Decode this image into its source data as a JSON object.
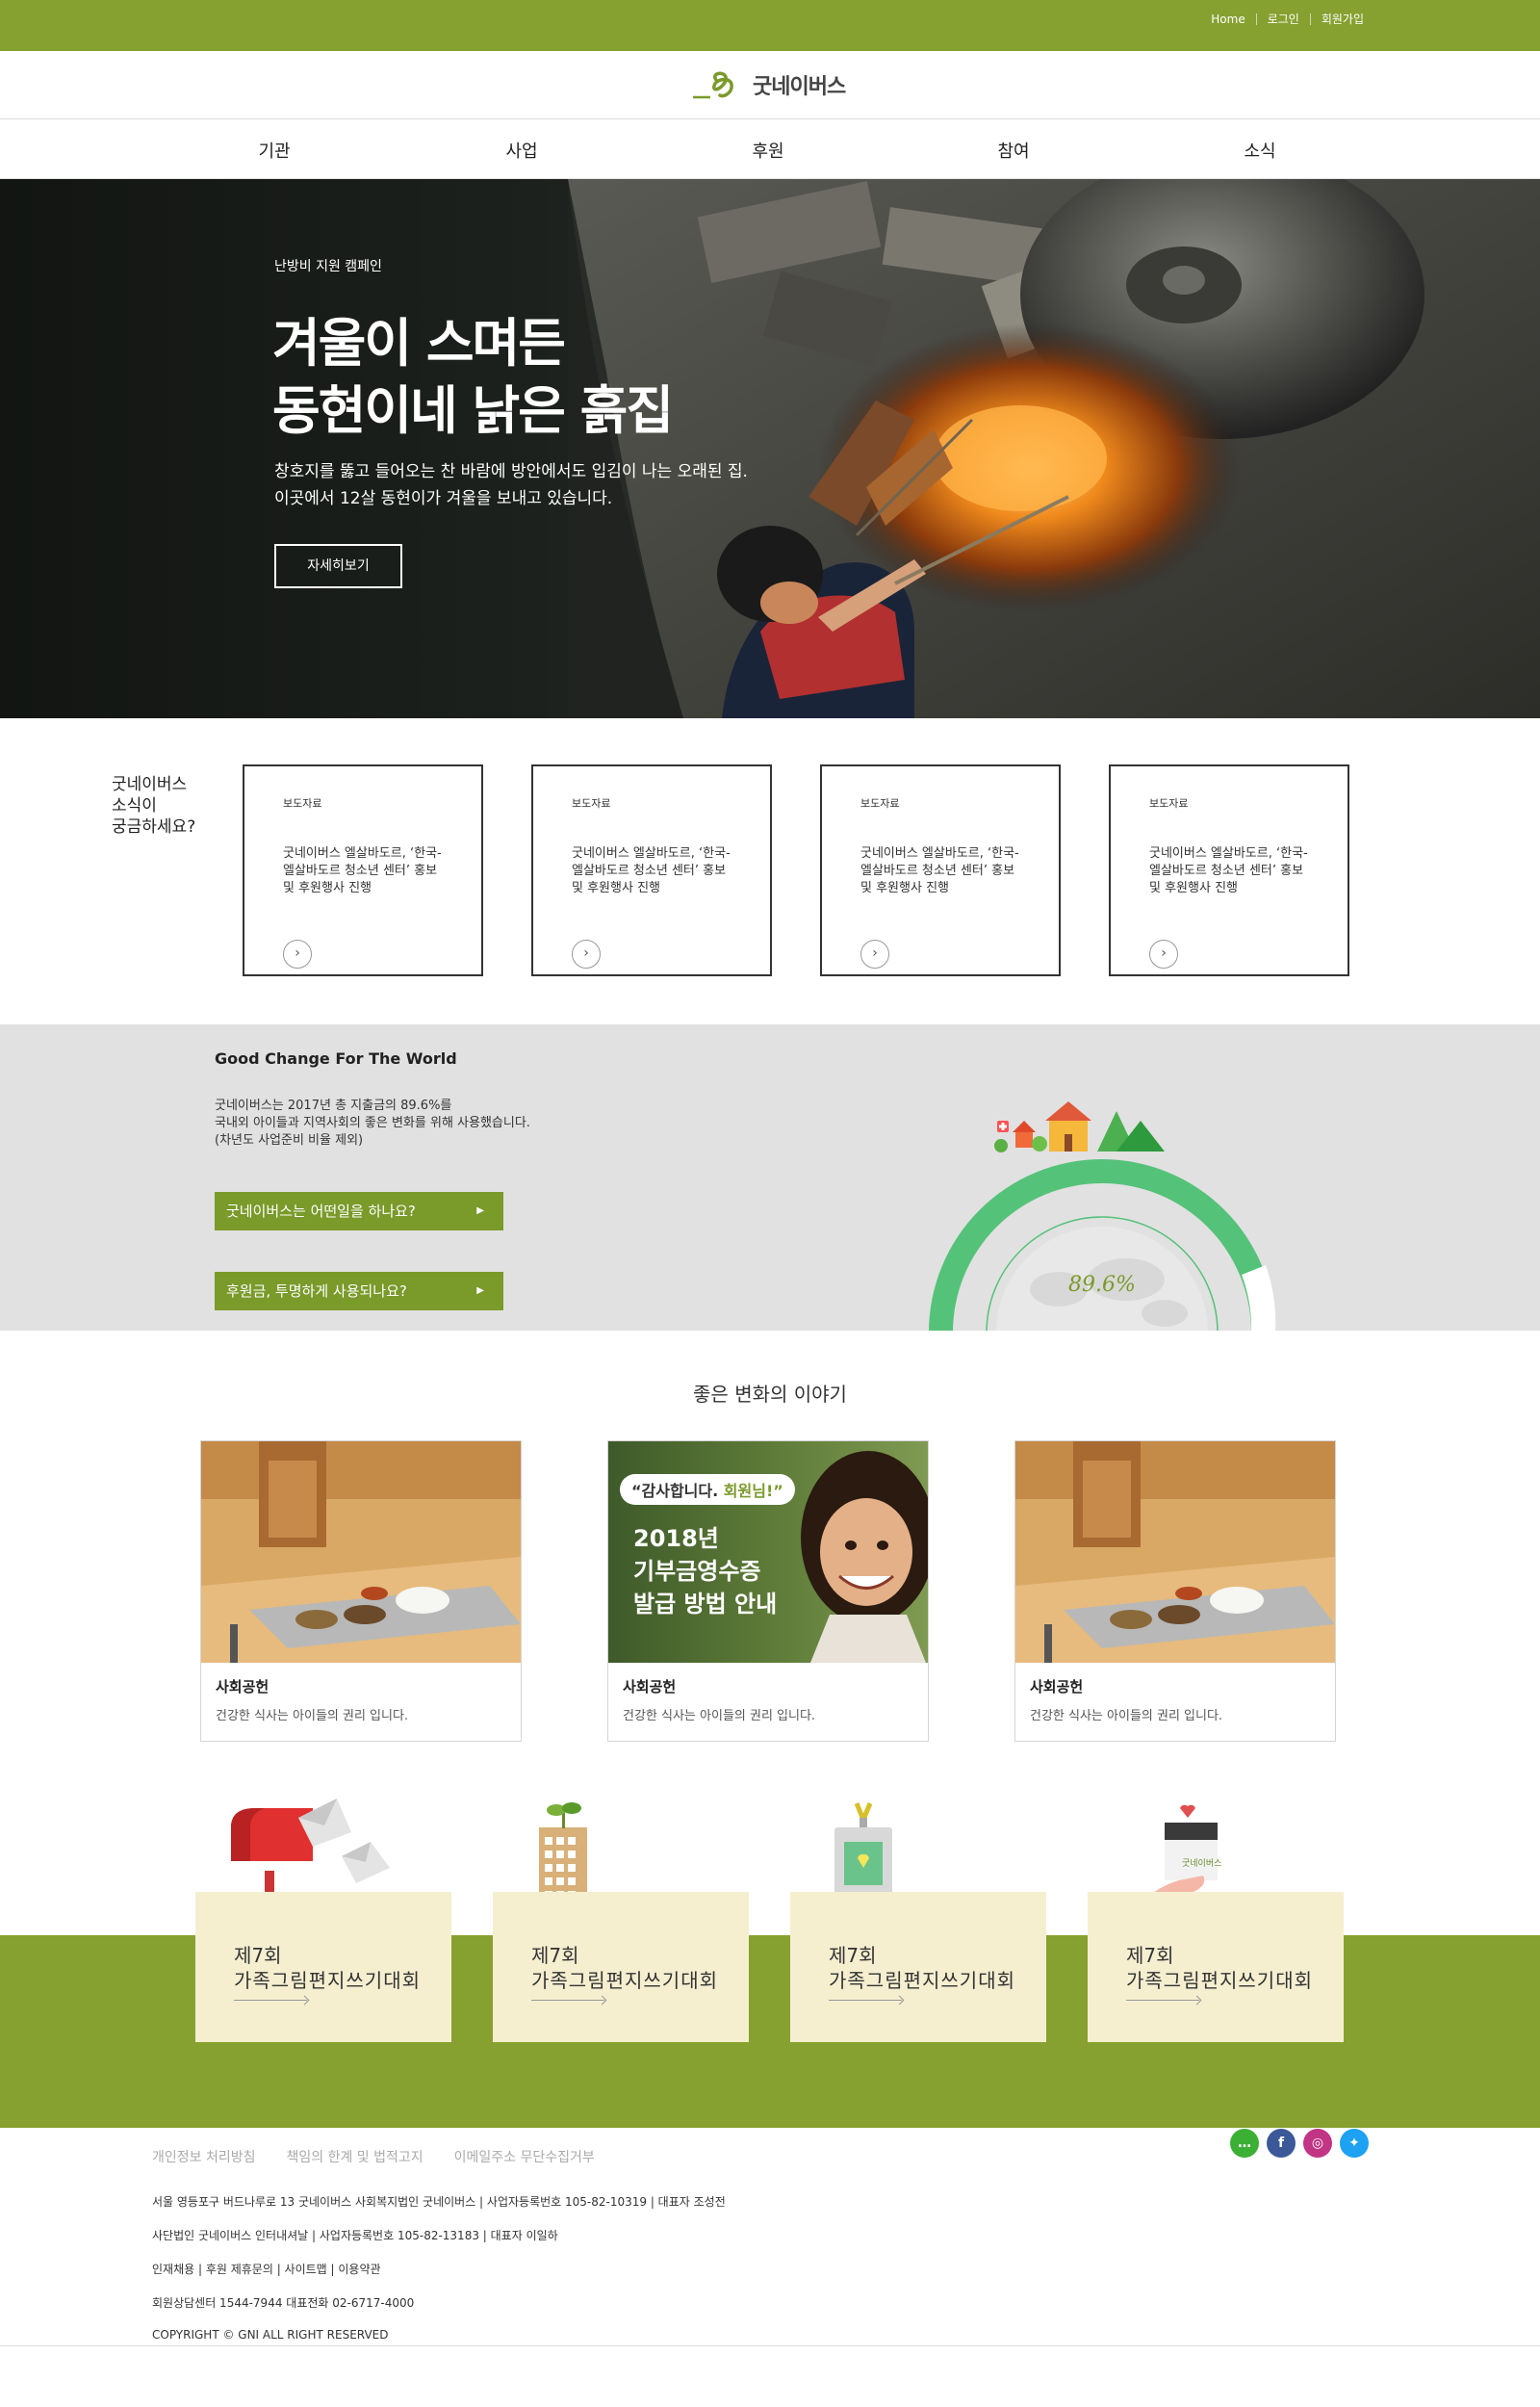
{
  "topbar": {
    "links": [
      "Home",
      "로그인",
      "회원가입"
    ]
  },
  "logo": {
    "text": "굿네이버스"
  },
  "nav": {
    "items": [
      "기관",
      "사업",
      "후원",
      "참여",
      "소식"
    ]
  },
  "hero": {
    "kicker": "난방비 지원 캠페인",
    "title_line1": "겨울이 스며든",
    "title_line2": "동현이네 낡은 흙집",
    "desc_line1": "창호지를 뚫고 들어오는 찬 바람에 방안에서도 입김이 나는 오래된 집.",
    "desc_line2": "이곳에서 12살 동현이가 겨울을 보내고 있습니다.",
    "button": "자세히보기"
  },
  "news": {
    "heading_line1": "굿네이버스",
    "heading_line2": "소식이",
    "heading_line3": "궁금하세요?",
    "cards": [
      {
        "tag": "보도자료",
        "text": "굿네이버스 엘살바도르, ‘한국-엘살바도르 청소년 센터’ 홍보 및 후원행사 진행"
      },
      {
        "tag": "보도자료",
        "text": "굿네이버스 엘살바도르, ‘한국-엘살바도르 청소년 센터’ 홍보 및 후원행사 진행"
      },
      {
        "tag": "보도자료",
        "text": "굿네이버스 엘살바도르, ‘한국-엘살바도르 청소년 센터’ 홍보 및 후원행사 진행"
      },
      {
        "tag": "보도자료",
        "text": "굿네이버스 엘살바도르, ‘한국-엘살바도르 청소년 센터’ 홍보 및 후원행사 진행"
      }
    ]
  },
  "impact": {
    "title": "Good Change For The World",
    "desc_line1": "굿네이버스는 2017년 총 지출금의 89.6%를",
    "desc_line2": "국내외 아이들과 지역사회의 좋은 변화를 위해 사용했습니다.",
    "desc_line3": "(차년도 사업준비 비율 제외)",
    "button1": "굿네이버스는 어떤일을 하나요?",
    "button2": "후원금, 투명하게 사용되나요?",
    "percent_label": "89.6%",
    "percent_value": 89.6
  },
  "stories": {
    "title": "좋은 변화의 이야기",
    "cards": [
      {
        "category": "사회공헌",
        "text": "건강한 식사는 아이들의 권리 입니다."
      },
      {
        "category": "사회공헌",
        "text": "건강한 식사는 아이들의 권리 입니다.",
        "banner_quote": "“감사합니다.",
        "banner_quote_accent": "회원님!”",
        "banner_line1": "2018년",
        "banner_line2": "기부금영수증",
        "banner_line3": "발급 방법 안내"
      },
      {
        "category": "사회공헌",
        "text": "건강한 식사는 아이들의 권리 입니다."
      }
    ]
  },
  "contest": {
    "cards": [
      {
        "line1": "제7회",
        "line2": "가족그림편지쓰기대회",
        "icon": "mailbox-icon"
      },
      {
        "line1": "제7회",
        "line2": "가족그림편지쓰기대회",
        "icon": "building-plant-icon"
      },
      {
        "line1": "제7회",
        "line2": "가족그림편지쓰기대회",
        "icon": "id-badge-icon"
      },
      {
        "line1": "제7회",
        "line2": "가족그림편지쓰기대회",
        "icon": "giving-hand-icon"
      }
    ]
  },
  "footer": {
    "links": [
      "개인정보 처리방침",
      "책임의 한계 및 법적고지",
      "이메일주소 무단수집거부"
    ],
    "line1": "서울 영등포구 버드나루로 13 굿네이버스 사회복지법인 굿네이버스 | 사업자등록번호 105-82-10319 | 대표자 조성전",
    "line2": "사단법인 굿네이버스 인터내셔날 | 사업자등록번호 105-82-13183 | 대표자 이일하",
    "line3": "인재채용 | 후원 제휴문의 | 사이트맵 | 이용약관",
    "line4": "회원상담센터 1544-7944 대표전화 02-6717-4000",
    "line5": "COPYRIGHT © GNI ALL RIGHT RESERVED",
    "sns": [
      "talk-icon",
      "facebook-icon",
      "instagram-icon",
      "twitter-icon"
    ],
    "sns_colors": [
      "#3cb034",
      "#3b5998",
      "#c13584",
      "#1da1f2"
    ]
  }
}
